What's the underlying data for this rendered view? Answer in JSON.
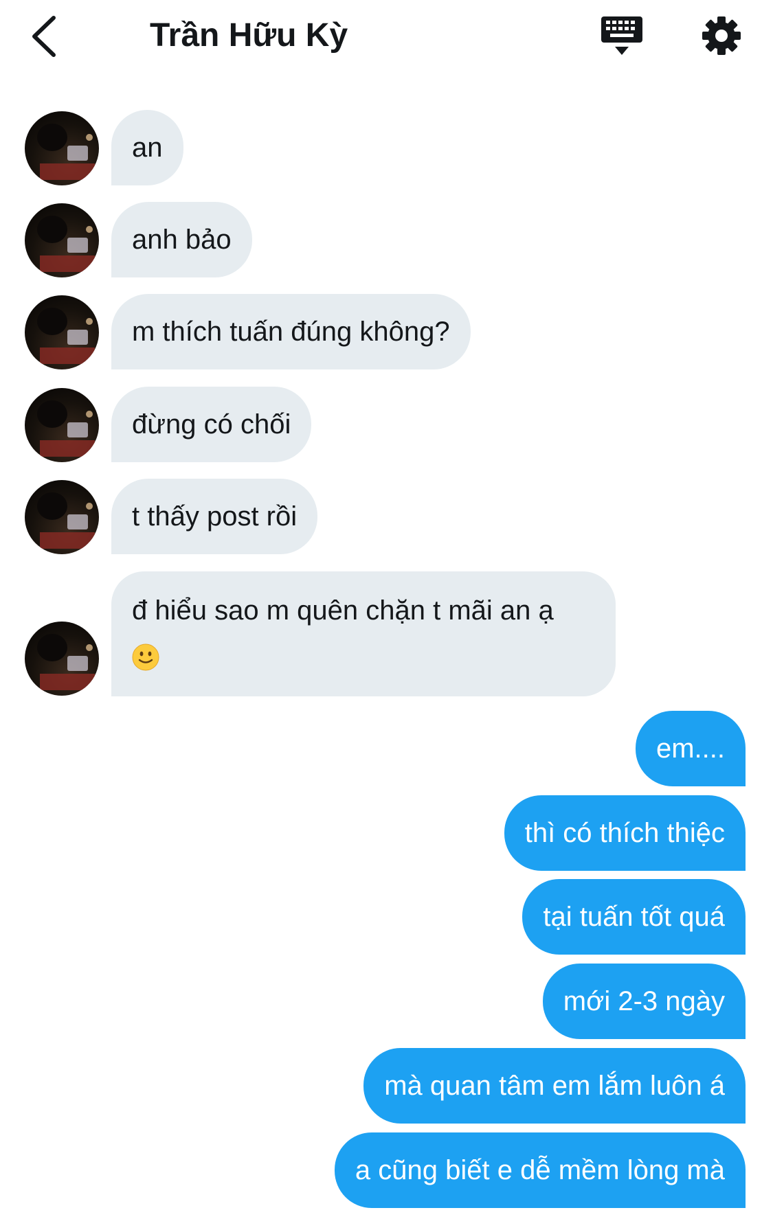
{
  "header": {
    "title": "Trần Hữu Kỳ",
    "back_icon": "chevron-left-icon",
    "keyboard_icon": "keyboard-icon",
    "settings_icon": "gear-icon"
  },
  "colors": {
    "incoming_bubble": "#e6ecf0",
    "outgoing_bubble": "#1da1f2",
    "text_dark": "#14171a",
    "text_light": "#ffffff"
  },
  "messages": {
    "incoming": [
      {
        "text": "an"
      },
      {
        "text": "anh bảo"
      },
      {
        "text": "m thích tuấn đúng không?"
      },
      {
        "text": "đừng có chối"
      },
      {
        "text": "t thấy post rồi"
      },
      {
        "text": "đ hiểu sao m quên chặn t mãi an ạ",
        "emoji": "slightly-smiling-face-icon"
      }
    ],
    "outgoing": [
      {
        "text": "em...."
      },
      {
        "text": "thì có thích thiệc"
      },
      {
        "text": "tại tuấn tốt quá"
      },
      {
        "text": "mới 2-3 ngày"
      },
      {
        "text": "mà quan tâm em lắm luôn á"
      },
      {
        "text": "a cũng biết e dễ mềm lòng mà"
      }
    ]
  }
}
